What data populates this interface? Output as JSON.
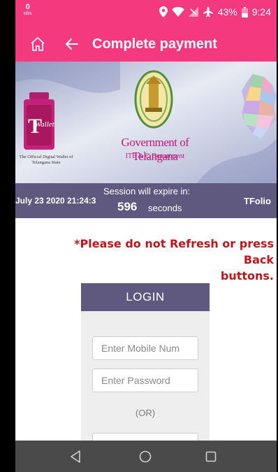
{
  "status_bar": {
    "net_speed_value": "0",
    "net_speed_unit": "kB/s",
    "battery_text": "43%",
    "time": "9:24",
    "icons": [
      "location-icon",
      "wifi-icon",
      "no-signal-icon",
      "airplane-icon",
      "battery-icon"
    ]
  },
  "app_bar": {
    "title": "Complete payment",
    "home_icon": "home-icon",
    "back_icon": "arrow-left-icon",
    "background": "#f5397e"
  },
  "banner": {
    "wallet_caption": "The Official Digital Wallet of Telangana State",
    "gov_title": "Government of Telangana",
    "gov_subtitle": "ITE & C Department",
    "wallet_logo_text": "Wallet"
  },
  "session": {
    "datetime": "July 23 2020 21:24:3",
    "label": "Session will expire in:",
    "count": "596",
    "unit": "seconds",
    "brand": "TFolio",
    "background": "#5f587f"
  },
  "warning": {
    "line1": "*Please do not Refresh or press Back",
    "line2": "buttons.",
    "color": "#c4141b"
  },
  "login": {
    "header": "LOGIN",
    "mobile_placeholder": "Enter Mobile Num",
    "password_placeholder": "Enter Password",
    "or_text": "(OR)"
  },
  "nav_bar": {
    "icons": [
      "nav-back-icon",
      "nav-home-icon",
      "nav-recent-icon"
    ]
  }
}
